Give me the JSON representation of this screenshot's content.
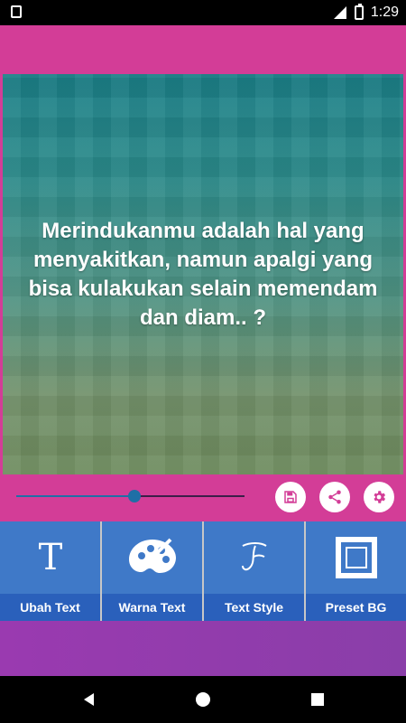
{
  "status": {
    "time": "1:29"
  },
  "preview": {
    "quote": "Merindukanmu adalah hal yang menyakitkan, namun apalgi yang bisa kulakukan selain memendam dan diam.. ?"
  },
  "controls": {
    "slider_value_fraction": 0.52,
    "buttons": [
      {
        "icon": "save-icon"
      },
      {
        "icon": "share-icon"
      },
      {
        "icon": "settings-icon"
      }
    ]
  },
  "toolbar": {
    "items": [
      {
        "label": "Ubah Text",
        "icon": "text-t-icon"
      },
      {
        "label": "Warna Text",
        "icon": "palette-icon"
      },
      {
        "label": "Text Style",
        "icon": "script-t-icon"
      },
      {
        "label": "Preset BG",
        "icon": "frame-icon"
      }
    ]
  },
  "colors": {
    "accent_pink": "#d33d97",
    "toolbar_blue": "#3f79c8",
    "footer_purple": "#9a3ab0"
  }
}
